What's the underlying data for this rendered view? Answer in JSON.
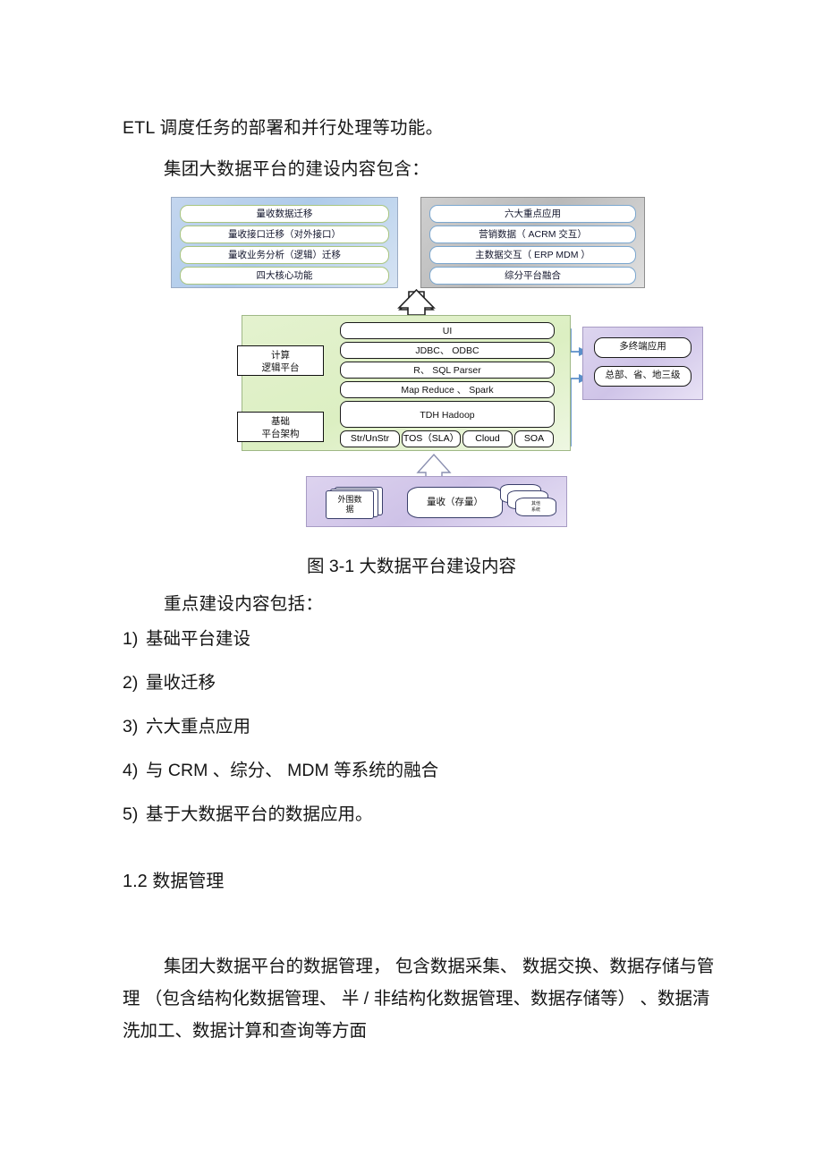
{
  "document": {
    "paragraph_etl": "ETL 调度任务的部署和并行处理等功能。",
    "paragraph_intro": "集团大数据平台的建设内容包含：",
    "figure_caption": "图 3-1 大数据平台建设内容",
    "paragraph_key": "重点建设内容包括：",
    "section_heading": "1.2 数据管理",
    "paragraph_tail": "集团大数据平台的数据管理， 包含数据采集、 数据交换、数据存储与管理 （包含结构化数据管理、 半 / 非结构化数据管理、数据存储等） 、数据清洗加工、数据计算和查询等方面"
  },
  "list": {
    "items": [
      {
        "num": "1)",
        "text": "基础平台建设"
      },
      {
        "num": "2)",
        "text": "量收迁移"
      },
      {
        "num": "3)",
        "text": "六大重点应用"
      },
      {
        "num": "4)",
        "text": "与 CRM 、综分、 MDM  等系统的融合"
      },
      {
        "num": "5)",
        "text": "基于大数据平台的数据应用。"
      }
    ]
  },
  "figure": {
    "panel_left": {
      "items": [
        "量收数据迁移",
        "量收接口迁移（对外接口）",
        "量收业务分析（逻辑）迁移",
        "四大核心功能"
      ]
    },
    "panel_right": {
      "items": [
        "六大重点应用",
        "营销数据（   ACRM 交互）",
        "主数据交互（   ERP MDM  ）",
        "综分平台融合"
      ]
    },
    "platform_labels": {
      "compute_line1": "计算",
      "compute_line2": "逻辑平台",
      "base_line1": "基础",
      "base_line2": "平台架构"
    },
    "stack_rows": [
      "UI",
      "JDBC、 ODBC",
      "R、 SQL Parser",
      "Map Reduce 、 Spark",
      "TDH Hadoop"
    ],
    "bottom_cells": [
      "Str/UnStr",
      "TOS（SLA）",
      "Cloud",
      "SOA"
    ],
    "panel_purple": {
      "items": [
        "多终端应用",
        "总部、省、地三级"
      ]
    },
    "data_sources": {
      "external_line1": "外围数",
      "external_line2": "据",
      "volume": "量收（存量）",
      "other_line1": "其他",
      "other_line2": "系统"
    }
  },
  "colors": {
    "panel_left_bg": "#aecbea",
    "panel_right_bg": "#b9b9b9",
    "green_panel_bg": "#dcefc2",
    "purple_panel_bg": "#cfc4e8",
    "arrow_blue": "#5b8fc9",
    "pill_green_border": "#a9c57f",
    "pill_blue_border": "#7ba7cf"
  }
}
